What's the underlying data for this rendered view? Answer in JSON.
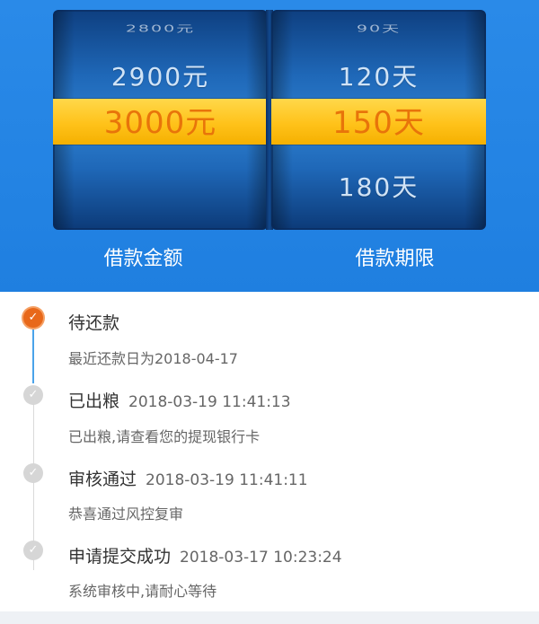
{
  "amount_picker": {
    "faint": "2800元",
    "prev": "2900元",
    "selected": "3000元",
    "next": "",
    "label": "借款金额"
  },
  "term_picker": {
    "faint": "90天",
    "prev": "120天",
    "selected": "150天",
    "next": "180天",
    "label": "借款期限"
  },
  "timeline": [
    {
      "title": "待还款",
      "time": "",
      "desc": "最近还款日为2018-04-17",
      "status": "active"
    },
    {
      "title": "已出粮",
      "time": "2018-03-19 11:41:13",
      "desc": "已出粮,请查看您的提现银行卡",
      "status": "done"
    },
    {
      "title": "审核通过",
      "time": "2018-03-19 11:41:11",
      "desc": "恭喜通过风控复审",
      "status": "done"
    },
    {
      "title": "申请提交成功",
      "time": "2018-03-17 10:23:24",
      "desc": "系统审核中,请耐心等待",
      "status": "done"
    }
  ],
  "colors": {
    "header_blue": "#2a8ae8",
    "selection_yellow": "#ffc21a",
    "selection_text": "#e8740a",
    "active_dot": "#e8681a",
    "inactive_dot": "#d6d6d6"
  },
  "icons": {
    "active_step": "check-circle-icon",
    "done_step": "check-circle-icon"
  }
}
